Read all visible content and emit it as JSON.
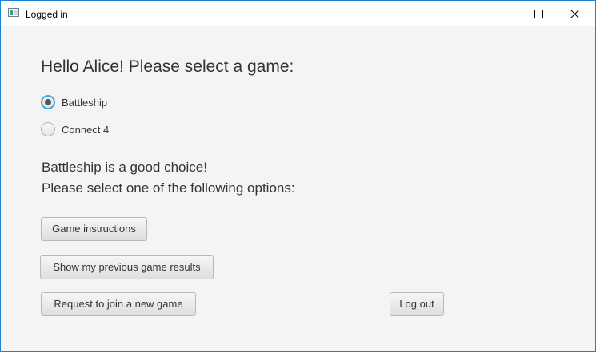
{
  "window": {
    "title": "Logged in",
    "icon": "java-app-icon",
    "controls": [
      "minimize-icon",
      "maximize-icon",
      "close-icon"
    ]
  },
  "main": {
    "heading": "Hello Alice! Please select a game:",
    "games": [
      {
        "label": "Battleship",
        "selected": true
      },
      {
        "label": "Connect 4",
        "selected": false
      }
    ],
    "choice_text": "Battleship is a good choice!",
    "prompt_text": "Please select one of the following options:",
    "buttons": {
      "instructions": "Game instructions",
      "previous_results": "Show my previous game results",
      "join_game": "Request to join a new game",
      "logout": "Log out"
    }
  },
  "colors": {
    "window_border": "#1883d7",
    "background": "#f4f4f4",
    "focus_ring": "#3fa8e6"
  }
}
